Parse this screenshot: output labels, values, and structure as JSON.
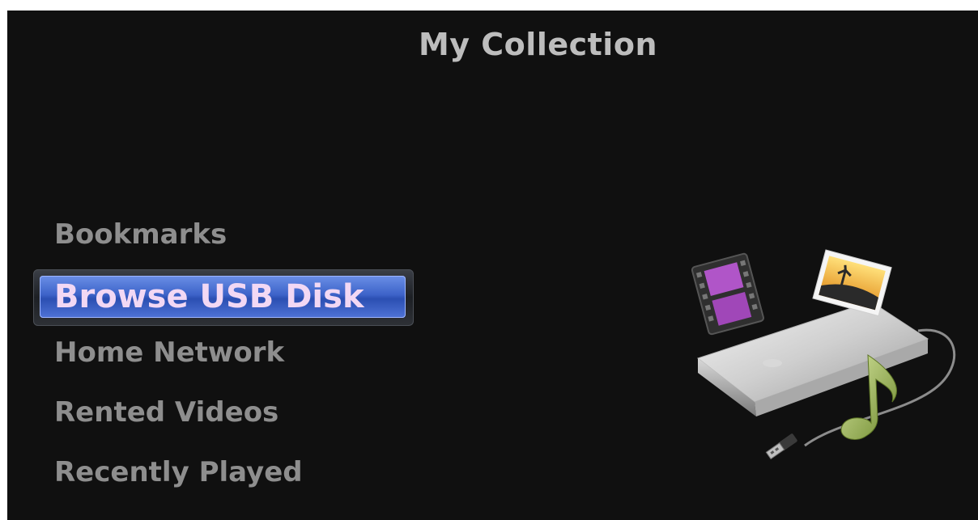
{
  "header": {
    "title": "My Collection"
  },
  "menu": {
    "items": [
      {
        "label": "Bookmarks"
      },
      {
        "label": "Browse USB Disk"
      },
      {
        "label": "Home Network"
      },
      {
        "label": "Rented Videos"
      },
      {
        "label": "Recently Played"
      }
    ],
    "selected_index": 1
  },
  "colors": {
    "background": "#101010",
    "text": "#8e8e8e",
    "title": "#bdbdbd",
    "highlight": "#3d63c9",
    "highlight_text": "#f2d8f4"
  },
  "icons": {
    "illustration": "usb-disk-icon"
  }
}
